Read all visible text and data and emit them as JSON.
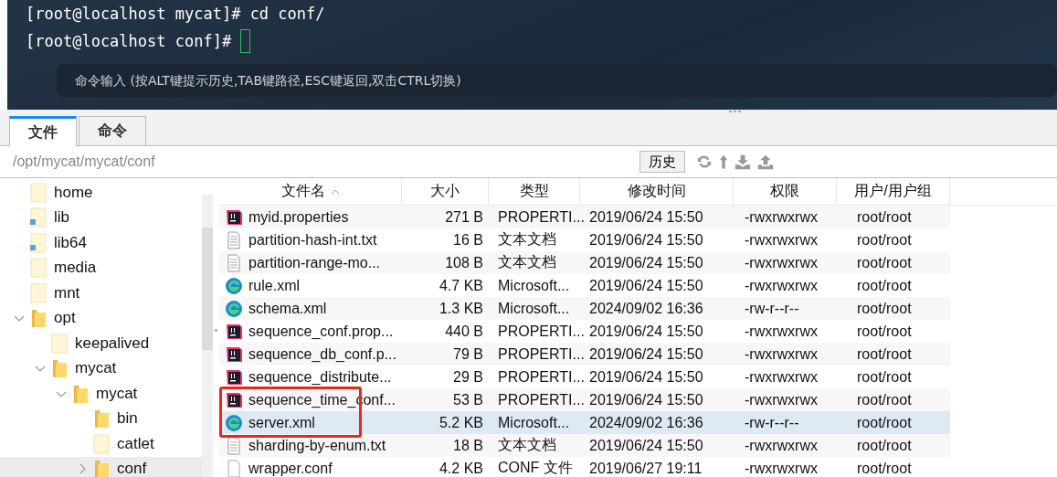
{
  "terminal": {
    "lines": [
      {
        "prompt": "[root@localhost mycat]#",
        "command": "cd conf/"
      },
      {
        "prompt": "[root@localhost conf]#",
        "cursor": true
      }
    ],
    "command_input": {
      "placeholder": "命令输入 (按ALT键提示历史,TAB键路径,ESC键返回,双击CTRL切换)"
    }
  },
  "tabs": [
    {
      "label": "文件",
      "selected": true
    },
    {
      "label": "命令",
      "selected": false
    }
  ],
  "path_bar": {
    "path": "/opt/mycat/mycat/conf",
    "history_button": "历史"
  },
  "tree": [
    {
      "label": "home",
      "kind": "empty",
      "selected": false
    },
    {
      "label": "lib",
      "kind": "link",
      "selected": false
    },
    {
      "label": "lib64",
      "kind": "link",
      "selected": false
    },
    {
      "label": "media",
      "kind": "empty",
      "selected": false
    },
    {
      "label": "mnt",
      "kind": "empty",
      "selected": false
    },
    {
      "label": "opt",
      "kind": "folder",
      "selected": false,
      "expanded": true,
      "children": [
        {
          "label": "keepalived",
          "kind": "empty",
          "selected": false
        },
        {
          "label": "mycat",
          "kind": "folder",
          "selected": false,
          "expanded": true,
          "children": [
            {
              "label": "mycat",
              "kind": "folder",
              "selected": false,
              "expanded": true,
              "children": [
                {
                  "label": "bin",
                  "kind": "folder",
                  "selected": false
                },
                {
                  "label": "catlet",
                  "kind": "empty",
                  "selected": false
                },
                {
                  "label": "conf",
                  "kind": "folder",
                  "selected": true,
                  "expanded": false
                }
              ]
            }
          ]
        }
      ]
    }
  ],
  "table": {
    "columns": [
      "文件名",
      "大小",
      "类型",
      "修改时间",
      "权限",
      "用户/用户组"
    ],
    "rows": [
      {
        "kind": "properties",
        "name": "myid.properties",
        "size": "271 B",
        "type": "PROPERTI...",
        "modified": "2019/06/24 15:50",
        "permissions": "-rwxrwxrwx",
        "owner": "root/root",
        "selected": false
      },
      {
        "kind": "text",
        "name": "partition-hash-int.txt",
        "size": "16 B",
        "type": "文本文档",
        "modified": "2019/06/24 15:50",
        "permissions": "-rwxrwxrwx",
        "owner": "root/root",
        "selected": false
      },
      {
        "kind": "text",
        "name": "partition-range-mo...",
        "size": "108 B",
        "type": "文本文档",
        "modified": "2019/06/24 15:50",
        "permissions": "-rwxrwxrwx",
        "owner": "root/root",
        "selected": false
      },
      {
        "kind": "xml",
        "name": "rule.xml",
        "size": "4.7 KB",
        "type": "Microsoft...",
        "modified": "2019/06/24 15:50",
        "permissions": "-rwxrwxrwx",
        "owner": "root/root",
        "selected": false
      },
      {
        "kind": "xml",
        "name": "schema.xml",
        "size": "1.3 KB",
        "type": "Microsoft...",
        "modified": "2024/09/02 16:36",
        "permissions": "-rw-r--r--",
        "owner": "root/root",
        "selected": false
      },
      {
        "kind": "properties",
        "name": "sequence_conf.prop...",
        "size": "440 B",
        "type": "PROPERTI...",
        "modified": "2019/06/24 15:50",
        "permissions": "-rwxrwxrwx",
        "owner": "root/root",
        "selected": false
      },
      {
        "kind": "properties",
        "name": "sequence_db_conf.p...",
        "size": "79 B",
        "type": "PROPERTI...",
        "modified": "2019/06/24 15:50",
        "permissions": "-rwxrwxrwx",
        "owner": "root/root",
        "selected": false
      },
      {
        "kind": "properties",
        "name": "sequence_distribute...",
        "size": "29 B",
        "type": "PROPERTI...",
        "modified": "2019/06/24 15:50",
        "permissions": "-rwxrwxrwx",
        "owner": "root/root",
        "selected": false
      },
      {
        "kind": "properties",
        "name": "sequence_time_conf...",
        "size": "53 B",
        "type": "PROPERTI...",
        "modified": "2019/06/24 15:50",
        "permissions": "-rwxrwxrwx",
        "owner": "root/root",
        "selected": false
      },
      {
        "kind": "xml",
        "name": "server.xml",
        "size": "5.2 KB",
        "type": "Microsoft...",
        "modified": "2024/09/02 16:36",
        "permissions": "-rw-r--r--",
        "owner": "root/root",
        "selected": true,
        "marked": true
      },
      {
        "kind": "text",
        "name": "sharding-by-enum.txt",
        "size": "18 B",
        "type": "文本文档",
        "modified": "2019/06/24 15:50",
        "permissions": "-rwxrwxrwx",
        "owner": "root/root",
        "selected": false
      },
      {
        "kind": "conf",
        "name": "wrapper.conf",
        "size": "4.2 KB",
        "type": "CONF 文件",
        "modified": "2019/06/27 19:11",
        "permissions": "-rwxrwxrwx",
        "owner": "root/root",
        "selected": false
      }
    ]
  }
}
